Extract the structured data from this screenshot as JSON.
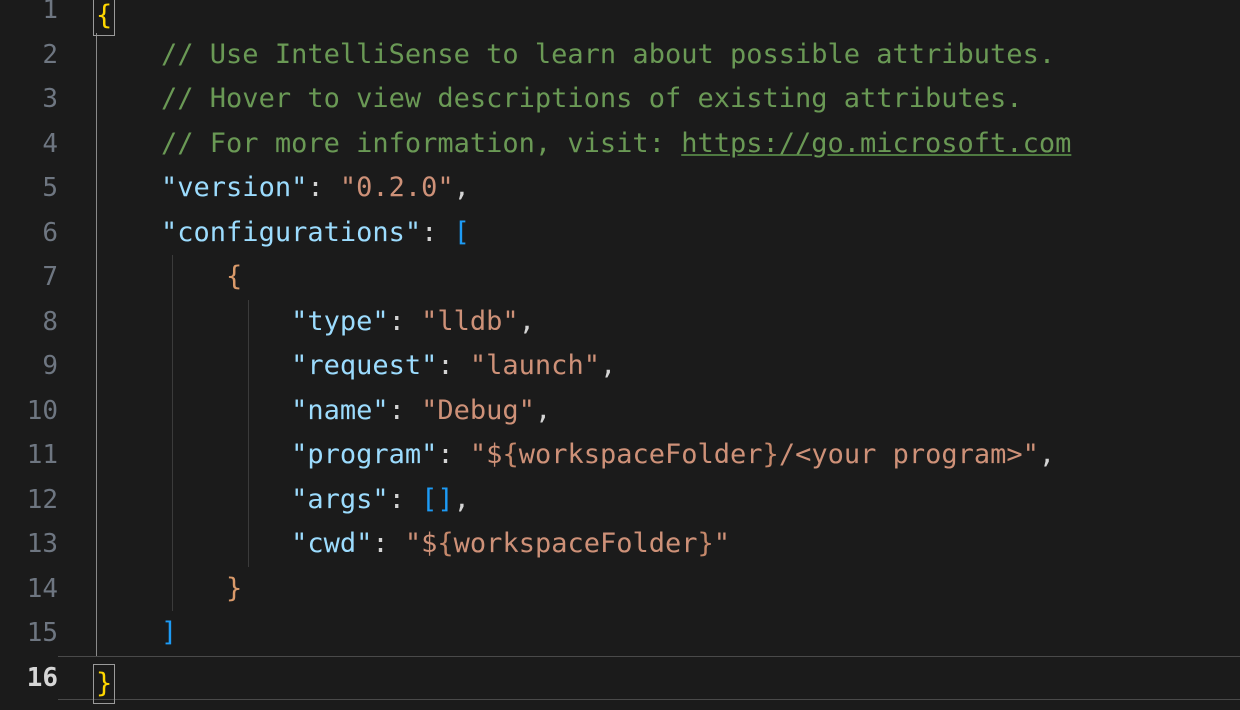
{
  "editor": {
    "file": "launch.json",
    "language": "jsonc",
    "background_color": "#1b1b1b",
    "line_number_color": "#6e7681",
    "active_line_number_color": "#d6d6d6",
    "active_line": 16,
    "first_visible_line": 1,
    "last_visible_line": 16,
    "colors": {
      "comment": "#6a9955",
      "property_key": "#9cdcfe",
      "string_value": "#ce9178",
      "punctuation": "#d4d4d4",
      "bracket_level_1": "#ffd700",
      "bracket_level_2": "#1d9bf5",
      "bracket_level_3": "#da9a6a",
      "indent_guide": "#3b3b3b",
      "indent_guide_active": "#8a8a8a",
      "bracket_match_border": "#9a9a9a",
      "active_line_border": "#4a4a4a"
    },
    "indent_guide_columns": [
      96,
      172,
      248
    ],
    "active_indent_guide_column": 96
  },
  "lines": [
    {
      "number": "1",
      "indent_guides": 0,
      "active": false,
      "bracket_matched": true,
      "tokens": [
        {
          "text": "{",
          "kind": "bracket_level_1",
          "bracket_match": true
        }
      ]
    },
    {
      "number": "2",
      "indent_guides": 1,
      "active": false,
      "tokens": [
        {
          "text": "    ",
          "kind": "punctuation"
        },
        {
          "text": "// Use IntelliSense to learn about possible attributes.",
          "kind": "comment"
        }
      ]
    },
    {
      "number": "3",
      "indent_guides": 1,
      "active": false,
      "tokens": [
        {
          "text": "    ",
          "kind": "punctuation"
        },
        {
          "text": "// Hover to view descriptions of existing attributes.",
          "kind": "comment"
        }
      ]
    },
    {
      "number": "4",
      "indent_guides": 1,
      "active": false,
      "tokens": [
        {
          "text": "    ",
          "kind": "punctuation"
        },
        {
          "text": "// For more information, visit: ",
          "kind": "comment"
        },
        {
          "text": "https://go.microsoft.com",
          "kind": "link"
        }
      ]
    },
    {
      "number": "5",
      "indent_guides": 1,
      "active": false,
      "tokens": [
        {
          "text": "    ",
          "kind": "punctuation"
        },
        {
          "text": "\"version\"",
          "kind": "property_key"
        },
        {
          "text": ": ",
          "kind": "punctuation"
        },
        {
          "text": "\"0.2.0\"",
          "kind": "string_value"
        },
        {
          "text": ",",
          "kind": "punctuation"
        }
      ]
    },
    {
      "number": "6",
      "indent_guides": 1,
      "active": false,
      "tokens": [
        {
          "text": "    ",
          "kind": "punctuation"
        },
        {
          "text": "\"configurations\"",
          "kind": "property_key"
        },
        {
          "text": ": ",
          "kind": "punctuation"
        },
        {
          "text": "[",
          "kind": "bracket_level_2"
        }
      ]
    },
    {
      "number": "7",
      "indent_guides": 2,
      "active": false,
      "tokens": [
        {
          "text": "        ",
          "kind": "punctuation"
        },
        {
          "text": "{",
          "kind": "bracket_level_3"
        }
      ]
    },
    {
      "number": "8",
      "indent_guides": 3,
      "active": false,
      "tokens": [
        {
          "text": "            ",
          "kind": "punctuation"
        },
        {
          "text": "\"type\"",
          "kind": "property_key"
        },
        {
          "text": ": ",
          "kind": "punctuation"
        },
        {
          "text": "\"lldb\"",
          "kind": "string_value"
        },
        {
          "text": ",",
          "kind": "punctuation"
        }
      ]
    },
    {
      "number": "9",
      "indent_guides": 3,
      "active": false,
      "tokens": [
        {
          "text": "            ",
          "kind": "punctuation"
        },
        {
          "text": "\"request\"",
          "kind": "property_key"
        },
        {
          "text": ": ",
          "kind": "punctuation"
        },
        {
          "text": "\"launch\"",
          "kind": "string_value"
        },
        {
          "text": ",",
          "kind": "punctuation"
        }
      ]
    },
    {
      "number": "10",
      "indent_guides": 3,
      "active": false,
      "tokens": [
        {
          "text": "            ",
          "kind": "punctuation"
        },
        {
          "text": "\"name\"",
          "kind": "property_key"
        },
        {
          "text": ": ",
          "kind": "punctuation"
        },
        {
          "text": "\"Debug\"",
          "kind": "string_value"
        },
        {
          "text": ",",
          "kind": "punctuation"
        }
      ]
    },
    {
      "number": "11",
      "indent_guides": 3,
      "active": false,
      "tokens": [
        {
          "text": "            ",
          "kind": "punctuation"
        },
        {
          "text": "\"program\"",
          "kind": "property_key"
        },
        {
          "text": ": ",
          "kind": "punctuation"
        },
        {
          "text": "\"",
          "kind": "string_value"
        },
        {
          "text": "$",
          "kind": "string_value"
        },
        {
          "text": "{",
          "kind": "variable_punct"
        },
        {
          "text": "workspaceFolder",
          "kind": "string_value"
        },
        {
          "text": "}",
          "kind": "variable_punct"
        },
        {
          "text": "/<your program>\"",
          "kind": "string_value"
        },
        {
          "text": ",",
          "kind": "punctuation"
        }
      ]
    },
    {
      "number": "12",
      "indent_guides": 3,
      "active": false,
      "tokens": [
        {
          "text": "            ",
          "kind": "punctuation"
        },
        {
          "text": "\"args\"",
          "kind": "property_key"
        },
        {
          "text": ": ",
          "kind": "punctuation"
        },
        {
          "text": "[]",
          "kind": "bracket_level_4"
        },
        {
          "text": ",",
          "kind": "punctuation"
        }
      ]
    },
    {
      "number": "13",
      "indent_guides": 3,
      "active": false,
      "tokens": [
        {
          "text": "            ",
          "kind": "punctuation"
        },
        {
          "text": "\"cwd\"",
          "kind": "property_key"
        },
        {
          "text": ": ",
          "kind": "punctuation"
        },
        {
          "text": "\"",
          "kind": "string_value"
        },
        {
          "text": "$",
          "kind": "string_value"
        },
        {
          "text": "{",
          "kind": "variable_punct"
        },
        {
          "text": "workspaceFolder",
          "kind": "string_value"
        },
        {
          "text": "}",
          "kind": "variable_punct"
        },
        {
          "text": "\"",
          "kind": "string_value"
        }
      ]
    },
    {
      "number": "14",
      "indent_guides": 2,
      "active": false,
      "tokens": [
        {
          "text": "        ",
          "kind": "punctuation"
        },
        {
          "text": "}",
          "kind": "bracket_level_3"
        }
      ]
    },
    {
      "number": "15",
      "indent_guides": 1,
      "active": false,
      "tokens": [
        {
          "text": "    ",
          "kind": "punctuation"
        },
        {
          "text": "]",
          "kind": "bracket_level_2"
        }
      ]
    },
    {
      "number": "16",
      "indent_guides": 0,
      "active": true,
      "bracket_matched": true,
      "tokens": [
        {
          "text": "}",
          "kind": "bracket_level_1",
          "bracket_match": true
        }
      ]
    }
  ]
}
